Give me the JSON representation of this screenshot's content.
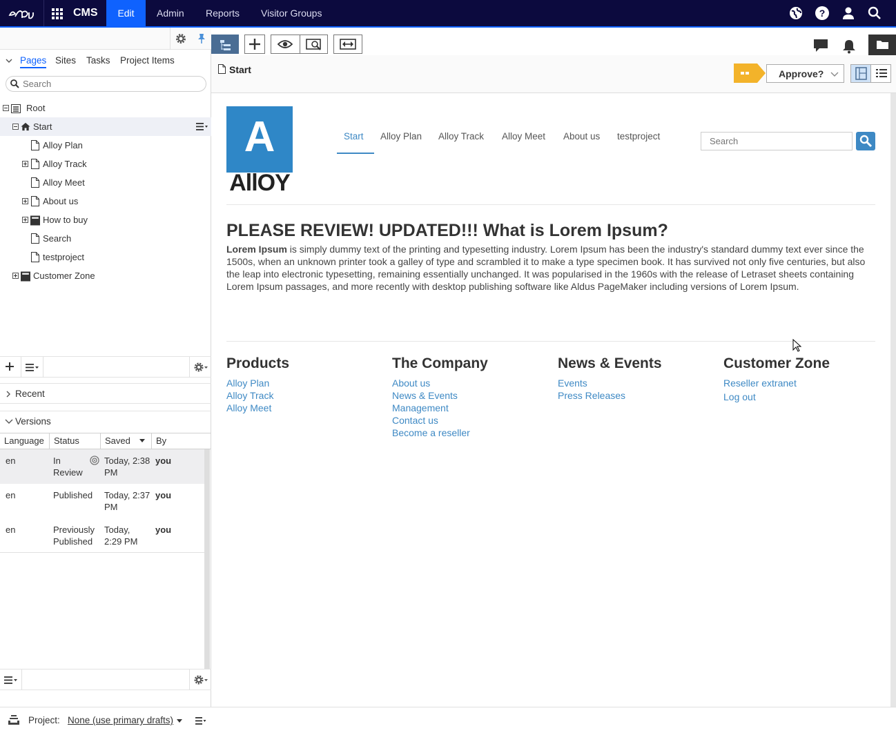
{
  "topbar": {
    "product": "CMS",
    "tabs": [
      "Edit",
      "Admin",
      "Reports",
      "Visitor Groups"
    ]
  },
  "left": {
    "tabs": [
      "Pages",
      "Sites",
      "Tasks",
      "Project Items"
    ],
    "search_placeholder": "Search",
    "tree": [
      {
        "label": "Root"
      },
      {
        "label": "Start"
      },
      {
        "label": "Alloy Plan"
      },
      {
        "label": "Alloy Track"
      },
      {
        "label": "Alloy Meet"
      },
      {
        "label": "About us"
      },
      {
        "label": "How to buy"
      },
      {
        "label": "Search"
      },
      {
        "label": "testproject"
      },
      {
        "label": "Customer Zone"
      }
    ],
    "recent": "Recent",
    "versions": "Versions",
    "version_columns": [
      "Language",
      "Status",
      "Saved",
      "By"
    ],
    "version_rows": [
      {
        "lang": "en",
        "status": "In Review",
        "saved": "Today, 2:38 PM",
        "by": "you"
      },
      {
        "lang": "en",
        "status": "Published",
        "saved": "Today, 2:37 PM",
        "by": "you"
      },
      {
        "lang": "en",
        "status": "Previously Published",
        "saved": "Today, 2:29 PM",
        "by": "you"
      }
    ]
  },
  "status": {
    "project_label": "Project:",
    "project_value": "None (use primary drafts)"
  },
  "main": {
    "crumb": "Start",
    "approve": "Approve?"
  },
  "site": {
    "logo_letter": "A",
    "logo_word": "AllOY",
    "nav": [
      "Start",
      "Alloy Plan",
      "Alloy Track",
      "Alloy Meet",
      "About us",
      "testproject"
    ],
    "search_placeholder": "Search",
    "heading": "PLEASE REVIEW! UPDATED!!! What is Lorem Ipsum?",
    "body_bold": "Lorem Ipsum",
    "body_rest": " is simply dummy text of the printing and typesetting industry. Lorem Ipsum has been the industry's standard dummy text ever since the 1500s, when an unknown printer took a galley of type and scrambled it to make a type specimen book. It has survived not only five centuries, but also the leap into electronic typesetting, remaining essentially unchanged. It was popularised in the 1960s with the release of Letraset sheets containing Lorem Ipsum passages, and more recently with desktop publishing software like Aldus PageMaker including versions of Lorem Ipsum.",
    "footer": [
      {
        "title": "Products",
        "links": [
          "Alloy Plan",
          "Alloy Track",
          "Alloy Meet"
        ]
      },
      {
        "title": "The Company",
        "links": [
          "About us",
          "News & Events",
          "Management",
          "Contact us",
          "Become a reseller"
        ]
      },
      {
        "title": "News & Events",
        "links": [
          "Events",
          "Press Releases"
        ]
      },
      {
        "title": "Customer Zone",
        "links": [
          "Reseller extranet",
          "Log out"
        ]
      }
    ]
  }
}
